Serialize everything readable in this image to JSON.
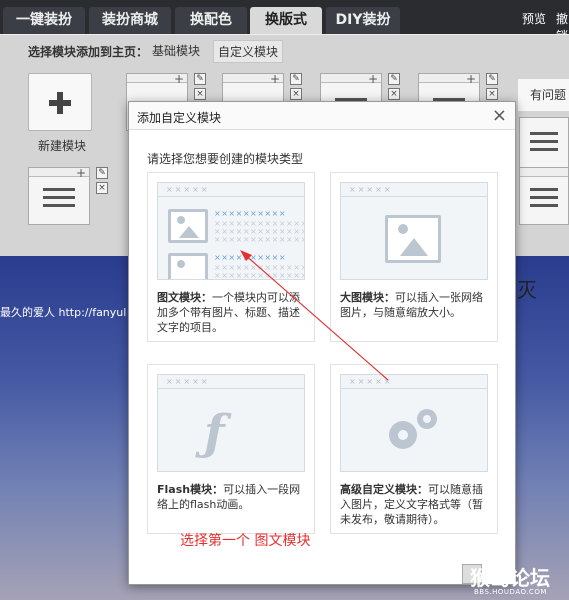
{
  "tabs": [
    "一键装扮",
    "装扮商城",
    "换配色",
    "换版式",
    "DIY装扮"
  ],
  "active_tab_index": 3,
  "topbar": {
    "preview": "预览",
    "undo": "撤销"
  },
  "panel": {
    "prompt": "选择模块添加到主页：",
    "links": [
      "基础模块",
      "自定义模块"
    ],
    "new_module_label": "新建模块",
    "side_label": "有问题"
  },
  "background": {
    "caption": "最久的爱人  http://fanyul",
    "partial_char": "灭"
  },
  "dialog": {
    "title": "添加自定义模块",
    "close_symbol": "×",
    "subtitle": "请选择您想要创建的模块类型",
    "cards": [
      {
        "name": "图文模块：",
        "desc": "一个模块内可以添加多个带有图片、标题、描述文字的项目。"
      },
      {
        "name": "大图模块：",
        "desc": "可以插入一张网络图片，与随意缩放大小。"
      },
      {
        "name": "Flash模块：",
        "desc": "可以插入一段网络上的flash动画。"
      },
      {
        "name": "高级自定义模块：",
        "desc": "可以随意插入图片，定义文字格式等（暂未发布，敬请期待）。"
      }
    ],
    "thumb_bar": "×××××"
  },
  "annotation": "选择第一个    图文模块",
  "watermark": {
    "title": "猴岛论坛",
    "url": "BBS.HOUDAO.COM"
  },
  "colors": {
    "annotation": "#e53030",
    "accent_blue": "#6aa1d8",
    "icon_gray": "#bcc6d1"
  }
}
